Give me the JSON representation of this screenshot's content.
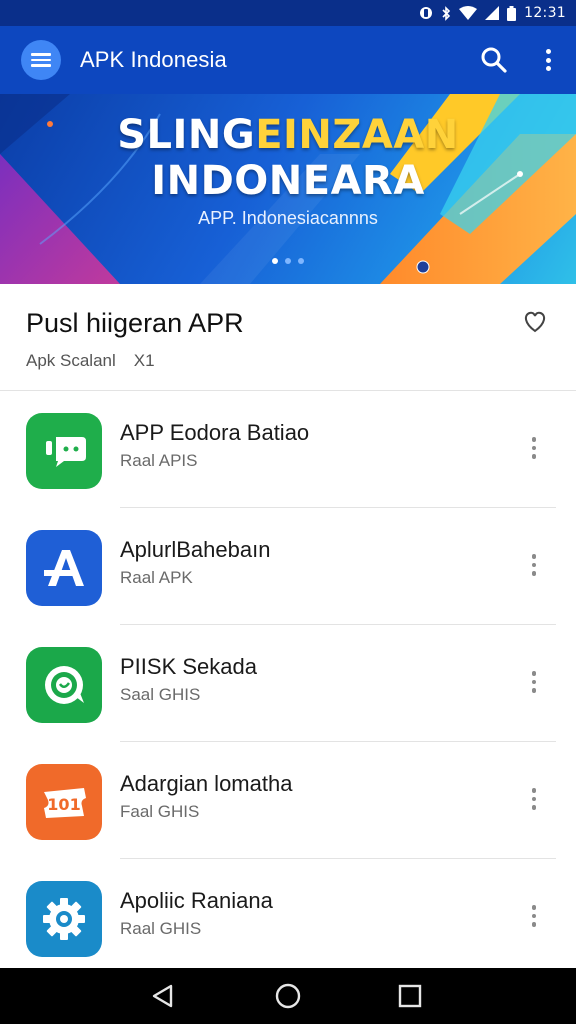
{
  "status_bar": {
    "time": "12:31",
    "icons": [
      "nfc-icon",
      "bluetooth-icon",
      "wifi-icon",
      "signal-icon",
      "battery-icon"
    ]
  },
  "app_bar": {
    "title": "APK Indonesia",
    "color": "#0d47bf",
    "icons": [
      "menu-icon",
      "search-icon",
      "more-vert-icon"
    ]
  },
  "banner": {
    "line1_white": "SLING",
    "line1_yellow": "EINZAAN",
    "line2": "INDONEARA",
    "subtitle": "APP. Indonesiacannns",
    "slide_count": 3,
    "active_slide": 1
  },
  "section": {
    "title": "Pusl hiigeran APR",
    "meta_label": "Apk Scalanl",
    "meta_value": "X1"
  },
  "apps": [
    {
      "name": "APP Eodora Batiao",
      "subtitle": "Raal APIS",
      "icon": "chat-bubble-icon",
      "color": "#1fae4b"
    },
    {
      "name": "AplurlBahebaın",
      "subtitle": "Raal APK",
      "icon": "letter-a-icon",
      "color": "#1f5fd6"
    },
    {
      "name": "PIISK Sekada",
      "subtitle": "Saal GHIS",
      "icon": "speech-ring-icon",
      "color": "#1ba84a"
    },
    {
      "name": "Adargian lomatha",
      "subtitle": "Faal GHIS",
      "icon": "ticket-icon",
      "color": "#f06a2a"
    },
    {
      "name": "Apoliic Raniana",
      "subtitle": "Raal GHIS",
      "icon": "gear-icon",
      "color": "#1a8bc9"
    }
  ],
  "nav_bar": {
    "icons": [
      "back-icon",
      "home-icon",
      "recents-icon"
    ]
  }
}
